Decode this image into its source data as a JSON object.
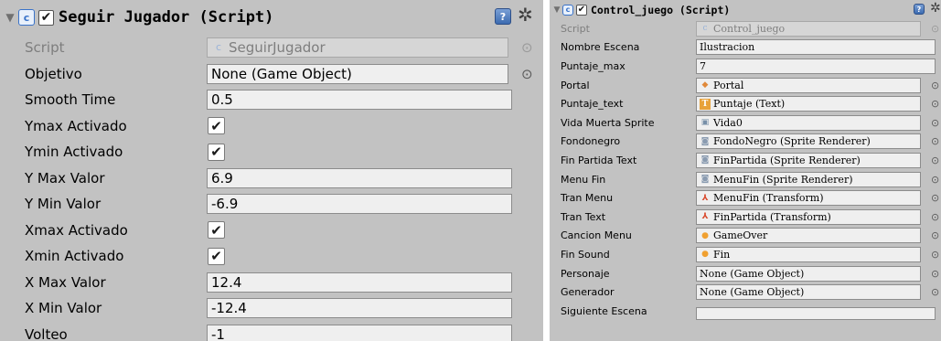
{
  "left": {
    "title": "Seguir Jugador (Script)",
    "script": {
      "label": "Script",
      "value": "SeguirJugador"
    },
    "objetivo": {
      "label": "Objetivo",
      "value": "None (Game Object)"
    },
    "smooth_time": {
      "label": "Smooth Time",
      "value": "0.5"
    },
    "ymax_activado": {
      "label": "Ymax Activado",
      "checked": true
    },
    "ymin_activado": {
      "label": "Ymin Activado",
      "checked": true
    },
    "y_max_valor": {
      "label": "Y Max Valor",
      "value": "6.9"
    },
    "y_min_valor": {
      "label": "Y Min Valor",
      "value": "-6.9"
    },
    "xmax_activado": {
      "label": "Xmax Activado",
      "checked": true
    },
    "xmin_activado": {
      "label": "Xmin Activado",
      "checked": true
    },
    "x_max_valor": {
      "label": "X Max Valor",
      "value": "12.4"
    },
    "x_min_valor": {
      "label": "X Min Valor",
      "value": "-12.4"
    },
    "volteo": {
      "label": "Volteo",
      "value": "-1"
    }
  },
  "right": {
    "title": "Control_juego (Script)",
    "script": {
      "label": "Script",
      "value": "Control_juego"
    },
    "nombre_escena": {
      "label": "Nombre Escena",
      "value": "Ilustracion"
    },
    "puntaje_max": {
      "label": "Puntaje_max",
      "value": "7"
    },
    "portal": {
      "label": "Portal",
      "value": "Portal"
    },
    "puntaje_text": {
      "label": "Puntaje_text",
      "value": "Puntaje (Text)"
    },
    "vida_muerta_sprite": {
      "label": "Vida Muerta Sprite",
      "value": "Vida0"
    },
    "fondonegro": {
      "label": "Fondonegro",
      "value": "FondoNegro (Sprite Renderer)"
    },
    "fin_partida_text": {
      "label": "Fin Partida Text",
      "value": "FinPartida (Sprite Renderer)"
    },
    "menu_fin": {
      "label": "Menu Fin",
      "value": "MenuFin (Sprite Renderer)"
    },
    "tran_menu": {
      "label": "Tran Menu",
      "value": "MenuFin (Transform)"
    },
    "tran_text": {
      "label": "Tran Text",
      "value": "FinPartida (Transform)"
    },
    "cancion_menu": {
      "label": "Cancion Menu",
      "value": "GameOver"
    },
    "fin_sound": {
      "label": "Fin Sound",
      "value": "Fin"
    },
    "personaje": {
      "label": "Personaje",
      "value": "None (Game Object)"
    },
    "generador": {
      "label": "Generador",
      "value": "None (Game Object)"
    },
    "siguiente_escena": {
      "label": "Siguiente Escena",
      "value": ""
    }
  },
  "icons": {
    "foldout": "▼",
    "check": "✔",
    "script": "c",
    "help": "?",
    "gear": "✲",
    "picker": "⊙",
    "prefab": "◆",
    "text_component": "T",
    "sprite": "▣",
    "sprite_renderer": "◙",
    "transform": "⅄",
    "audio": "●"
  },
  "colors": {
    "panel_bg": "#c2c2c2",
    "field_bg": "#efefef",
    "script_blue": "#3a73c9",
    "prefab_orange": "#e0893a",
    "text_yellow": "#e8a23a",
    "audio_orange": "#f0a030",
    "transform_red": "#d9482b"
  }
}
